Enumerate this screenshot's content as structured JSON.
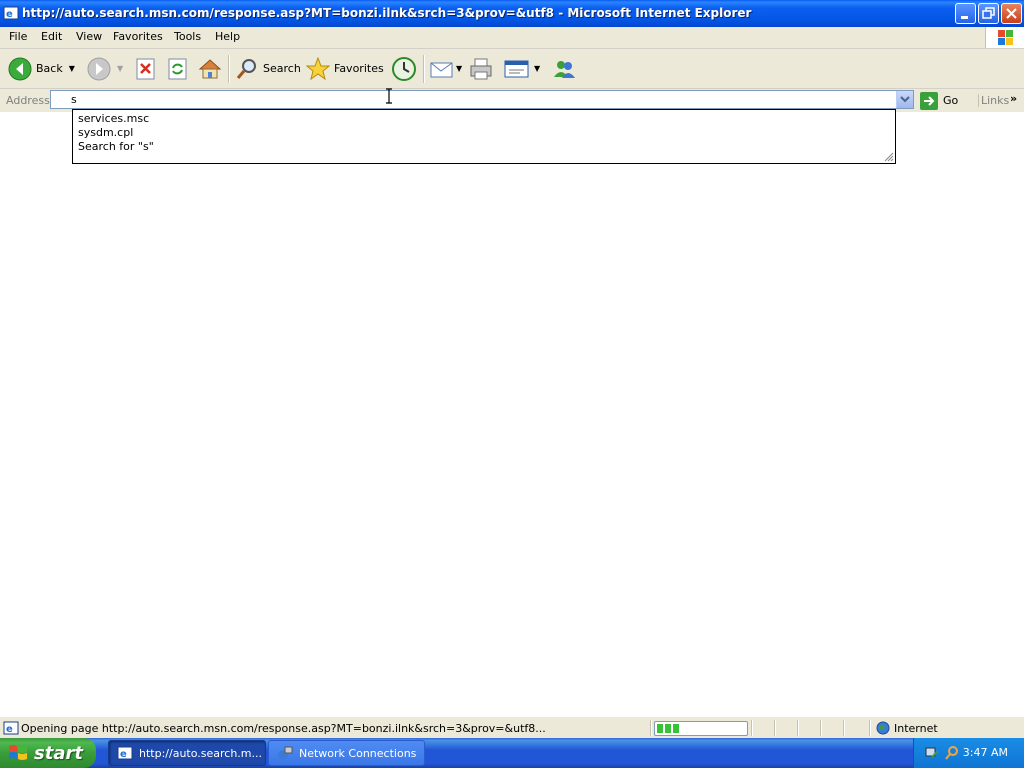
{
  "window": {
    "title": "http://auto.search.msn.com/response.asp?MT=bonzi.ilnk&srch=3&prov=&utf8 - Microsoft Internet Explorer"
  },
  "menu": {
    "items": [
      "File",
      "Edit",
      "View",
      "Favorites",
      "Tools",
      "Help"
    ]
  },
  "toolbar": {
    "back_label": "Back",
    "search_label": "Search",
    "favorites_label": "Favorites"
  },
  "address": {
    "label": "Address",
    "value": "s",
    "go_label": "Go",
    "links_label": "Links"
  },
  "autocomplete": {
    "items": [
      "services.msc",
      "sysdm.cpl",
      "Search for \"s\""
    ]
  },
  "status": {
    "text": "Opening page http://auto.search.msn.com/response.asp?MT=bonzi.ilnk&srch=3&prov=&utf8...",
    "zone": "Internet",
    "progress_fraction": 0.27
  },
  "taskbar": {
    "start_label": "start",
    "tasks": [
      "http://auto.search.m...",
      "Network Connections"
    ],
    "clock": "3:47 AM"
  },
  "colors": {
    "titlebar": "#0457e6",
    "taskbar": "#2157d7",
    "start": "#3a9d3a",
    "chrome": "#ece9d8"
  }
}
